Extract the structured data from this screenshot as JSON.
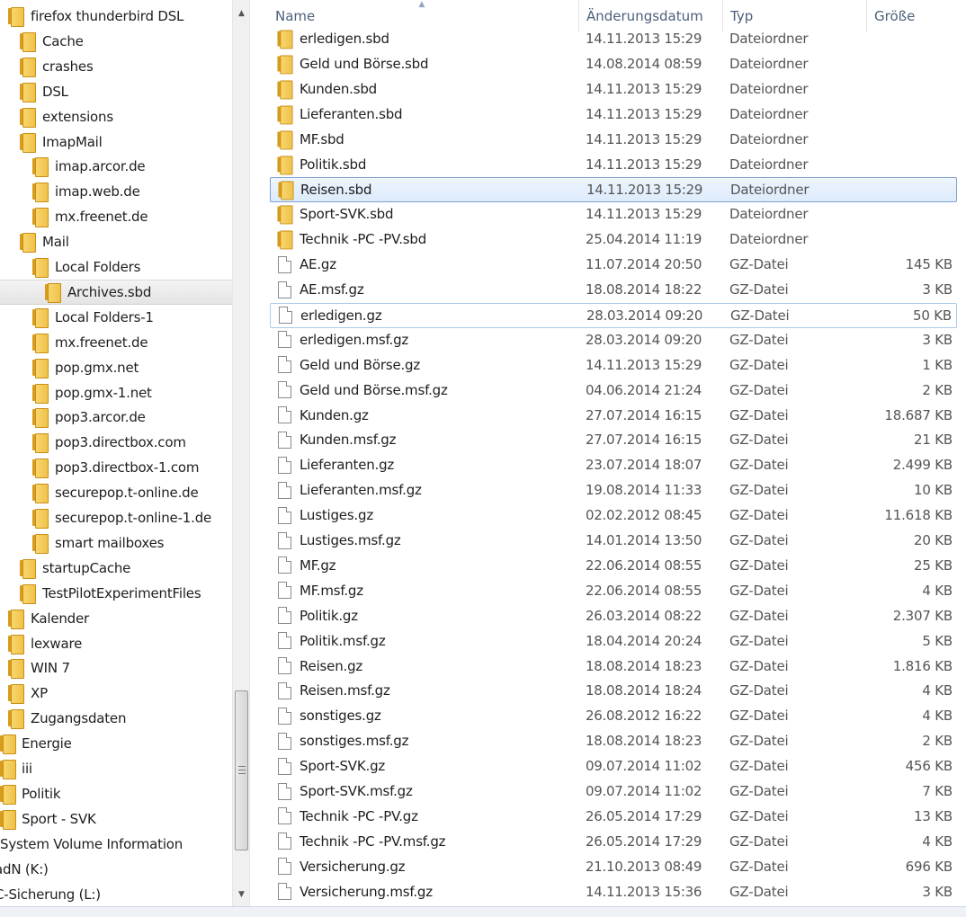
{
  "nav": {
    "items": [
      {
        "label": "firefox thunderbird DSL",
        "level": 1
      },
      {
        "label": "Cache",
        "level": 2
      },
      {
        "label": "crashes",
        "level": 2
      },
      {
        "label": "DSL",
        "level": 2
      },
      {
        "label": "extensions",
        "level": 2
      },
      {
        "label": "ImapMail",
        "level": 2
      },
      {
        "label": "imap.arcor.de",
        "level": 3
      },
      {
        "label": "imap.web.de",
        "level": 3
      },
      {
        "label": "mx.freenet.de",
        "level": 3
      },
      {
        "label": "Mail",
        "level": 2
      },
      {
        "label": "Local Folders",
        "level": 3
      },
      {
        "label": "Archives.sbd",
        "level": 4,
        "selected": true
      },
      {
        "label": "Local Folders-1",
        "level": 3
      },
      {
        "label": "mx.freenet.de",
        "level": 3
      },
      {
        "label": "pop.gmx.net",
        "level": 3
      },
      {
        "label": "pop.gmx-1.net",
        "level": 3
      },
      {
        "label": "pop3.arcor.de",
        "level": 3
      },
      {
        "label": "pop3.directbox.com",
        "level": 3
      },
      {
        "label": "pop3.directbox-1.com",
        "level": 3
      },
      {
        "label": "securepop.t-online.de",
        "level": 3
      },
      {
        "label": "securepop.t-online-1.de",
        "level": 3
      },
      {
        "label": "smart mailboxes",
        "level": 3
      },
      {
        "label": "startupCache",
        "level": 2
      },
      {
        "label": "TestPilotExperimentFiles",
        "level": 2
      },
      {
        "label": "Kalender",
        "level": 1
      },
      {
        "label": "lexware",
        "level": 1
      },
      {
        "label": "WIN 7",
        "level": 1
      },
      {
        "label": "XP",
        "level": 1
      },
      {
        "label": "Zugangsdaten",
        "level": 1
      },
      {
        "label": "Energie",
        "level": 0
      },
      {
        "label": "iii",
        "level": 0
      },
      {
        "label": "Politik",
        "level": 0
      },
      {
        "label": "Sport - SVK",
        "level": 0
      },
      {
        "label": "System Volume Information",
        "level": -1
      },
      {
        "label": "adN (K:)",
        "level": -2
      },
      {
        "label": "C-Sicherung (L:)",
        "level": -2
      }
    ]
  },
  "columns": {
    "name": "Name",
    "date": "Änderungsdatum",
    "type": "Typ",
    "size": "Größe"
  },
  "files": [
    {
      "name": "erledigen.sbd",
      "date": "14.11.2013 15:29",
      "type": "Dateiordner",
      "size": "",
      "icon": "folder"
    },
    {
      "name": "Geld und Börse.sbd",
      "date": "14.08.2014 08:59",
      "type": "Dateiordner",
      "size": "",
      "icon": "folder"
    },
    {
      "name": "Kunden.sbd",
      "date": "14.11.2013 15:29",
      "type": "Dateiordner",
      "size": "",
      "icon": "folder"
    },
    {
      "name": "Lieferanten.sbd",
      "date": "14.11.2013 15:29",
      "type": "Dateiordner",
      "size": "",
      "icon": "folder"
    },
    {
      "name": "MF.sbd",
      "date": "14.11.2013 15:29",
      "type": "Dateiordner",
      "size": "",
      "icon": "folder"
    },
    {
      "name": "Politik.sbd",
      "date": "14.11.2013 15:29",
      "type": "Dateiordner",
      "size": "",
      "icon": "folder"
    },
    {
      "name": "Reisen.sbd",
      "date": "14.11.2013 15:29",
      "type": "Dateiordner",
      "size": "",
      "icon": "folder",
      "state": "selected"
    },
    {
      "name": "Sport-SVK.sbd",
      "date": "14.11.2013 15:29",
      "type": "Dateiordner",
      "size": "",
      "icon": "folder"
    },
    {
      "name": "Technik -PC -PV.sbd",
      "date": "25.04.2014 11:19",
      "type": "Dateiordner",
      "size": "",
      "icon": "folder"
    },
    {
      "name": "AE.gz",
      "date": "11.07.2014 20:50",
      "type": "GZ-Datei",
      "size": "145 KB",
      "icon": "file"
    },
    {
      "name": "AE.msf.gz",
      "date": "18.08.2014 18:22",
      "type": "GZ-Datei",
      "size": "3 KB",
      "icon": "file"
    },
    {
      "name": "erledigen.gz",
      "date": "28.03.2014 09:20",
      "type": "GZ-Datei",
      "size": "50 KB",
      "icon": "file",
      "state": "focused"
    },
    {
      "name": "erledigen.msf.gz",
      "date": "28.03.2014 09:20",
      "type": "GZ-Datei",
      "size": "3 KB",
      "icon": "file"
    },
    {
      "name": "Geld und Börse.gz",
      "date": "14.11.2013 15:29",
      "type": "GZ-Datei",
      "size": "1 KB",
      "icon": "file"
    },
    {
      "name": "Geld und Börse.msf.gz",
      "date": "04.06.2014 21:24",
      "type": "GZ-Datei",
      "size": "2 KB",
      "icon": "file"
    },
    {
      "name": "Kunden.gz",
      "date": "27.07.2014 16:15",
      "type": "GZ-Datei",
      "size": "18.687 KB",
      "icon": "file"
    },
    {
      "name": "Kunden.msf.gz",
      "date": "27.07.2014 16:15",
      "type": "GZ-Datei",
      "size": "21 KB",
      "icon": "file"
    },
    {
      "name": "Lieferanten.gz",
      "date": "23.07.2014 18:07",
      "type": "GZ-Datei",
      "size": "2.499 KB",
      "icon": "file"
    },
    {
      "name": "Lieferanten.msf.gz",
      "date": "19.08.2014 11:33",
      "type": "GZ-Datei",
      "size": "10 KB",
      "icon": "file"
    },
    {
      "name": "Lustiges.gz",
      "date": "02.02.2012 08:45",
      "type": "GZ-Datei",
      "size": "11.618 KB",
      "icon": "file"
    },
    {
      "name": "Lustiges.msf.gz",
      "date": "14.01.2014 13:50",
      "type": "GZ-Datei",
      "size": "20 KB",
      "icon": "file"
    },
    {
      "name": "MF.gz",
      "date": "22.06.2014 08:55",
      "type": "GZ-Datei",
      "size": "25 KB",
      "icon": "file"
    },
    {
      "name": "MF.msf.gz",
      "date": "22.06.2014 08:55",
      "type": "GZ-Datei",
      "size": "4 KB",
      "icon": "file"
    },
    {
      "name": "Politik.gz",
      "date": "26.03.2014 08:22",
      "type": "GZ-Datei",
      "size": "2.307 KB",
      "icon": "file"
    },
    {
      "name": "Politik.msf.gz",
      "date": "18.04.2014 20:24",
      "type": "GZ-Datei",
      "size": "5 KB",
      "icon": "file"
    },
    {
      "name": "Reisen.gz",
      "date": "18.08.2014 18:23",
      "type": "GZ-Datei",
      "size": "1.816 KB",
      "icon": "file"
    },
    {
      "name": "Reisen.msf.gz",
      "date": "18.08.2014 18:24",
      "type": "GZ-Datei",
      "size": "4 KB",
      "icon": "file"
    },
    {
      "name": "sonstiges.gz",
      "date": "26.08.2012 16:22",
      "type": "GZ-Datei",
      "size": "4 KB",
      "icon": "file"
    },
    {
      "name": "sonstiges.msf.gz",
      "date": "18.08.2014 18:23",
      "type": "GZ-Datei",
      "size": "2 KB",
      "icon": "file"
    },
    {
      "name": "Sport-SVK.gz",
      "date": "09.07.2014 11:02",
      "type": "GZ-Datei",
      "size": "456 KB",
      "icon": "file"
    },
    {
      "name": "Sport-SVK.msf.gz",
      "date": "09.07.2014 11:02",
      "type": "GZ-Datei",
      "size": "7 KB",
      "icon": "file"
    },
    {
      "name": "Technik -PC -PV.gz",
      "date": "26.05.2014 17:29",
      "type": "GZ-Datei",
      "size": "13 KB",
      "icon": "file"
    },
    {
      "name": "Technik -PC -PV.msf.gz",
      "date": "26.05.2014 17:29",
      "type": "GZ-Datei",
      "size": "4 KB",
      "icon": "file"
    },
    {
      "name": "Versicherung.gz",
      "date": "21.10.2013 08:49",
      "type": "GZ-Datei",
      "size": "696 KB",
      "icon": "file"
    },
    {
      "name": "Versicherung.msf.gz",
      "date": "14.11.2013 15:36",
      "type": "GZ-Datei",
      "size": "3 KB",
      "icon": "file"
    }
  ],
  "colors": {
    "selection_border": "#7da2ce",
    "selection_fill": "#dcebfc",
    "header_text": "#4c607a",
    "folder_yellow": "#f8d66d"
  }
}
